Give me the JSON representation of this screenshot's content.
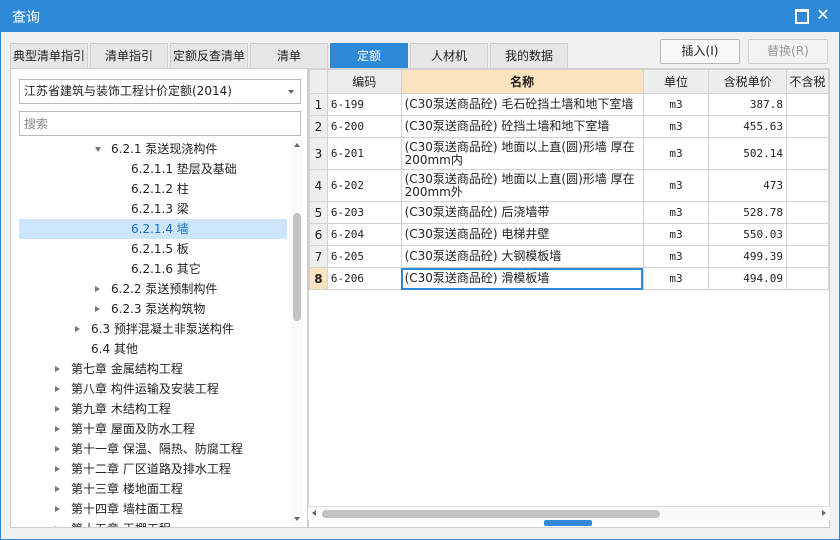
{
  "window": {
    "title": "查询"
  },
  "tabs": [
    {
      "label": "典型清单指引"
    },
    {
      "label": "清单指引"
    },
    {
      "label": "定额反查清单"
    },
    {
      "label": "清单"
    },
    {
      "label": "定额"
    },
    {
      "label": "人材机"
    },
    {
      "label": "我的数据"
    }
  ],
  "active_tab": "定额",
  "toolbar": {
    "insert_label": "插入(I)",
    "replace_label": "替换(R)"
  },
  "left": {
    "dropdown_value": "江苏省建筑与装饰工程计价定额(2014)",
    "search_placeholder": "搜索",
    "tree": [
      {
        "label": "6.2.1 泵送现浇构件",
        "level": 2,
        "arrow": "down"
      },
      {
        "label": "6.2.1.1 垫层及基础",
        "level": 3,
        "arrow": ""
      },
      {
        "label": "6.2.1.2 柱",
        "level": 3,
        "arrow": ""
      },
      {
        "label": "6.2.1.3 梁",
        "level": 3,
        "arrow": ""
      },
      {
        "label": "6.2.1.4 墙",
        "level": 3,
        "arrow": "",
        "selected": true
      },
      {
        "label": "6.2.1.5 板",
        "level": 3,
        "arrow": ""
      },
      {
        "label": "6.2.1.6 其它",
        "level": 3,
        "arrow": ""
      },
      {
        "label": "6.2.2 泵送预制构件",
        "level": 2,
        "arrow": "right"
      },
      {
        "label": "6.2.3 泵送构筑物",
        "level": 2,
        "arrow": "right"
      },
      {
        "label": "6.3 预拌混凝土非泵送构件",
        "level": 1,
        "arrow": "right"
      },
      {
        "label": "6.4 其他",
        "level": 1,
        "arrow": ""
      },
      {
        "label": "第七章 金属结构工程",
        "level": 0,
        "arrow": "right"
      },
      {
        "label": "第八章 构件运输及安装工程",
        "level": 0,
        "arrow": "right"
      },
      {
        "label": "第九章 木结构工程",
        "level": 0,
        "arrow": "right"
      },
      {
        "label": "第十章 屋面及防水工程",
        "level": 0,
        "arrow": "right"
      },
      {
        "label": "第十一章 保温、隔热、防腐工程",
        "level": 0,
        "arrow": "right"
      },
      {
        "label": "第十二章 厂区道路及排水工程",
        "level": 0,
        "arrow": "right"
      },
      {
        "label": "第十三章 楼地面工程",
        "level": 0,
        "arrow": "right"
      },
      {
        "label": "第十四章 墙柱面工程",
        "level": 0,
        "arrow": "right"
      },
      {
        "label": "第十五章 天棚工程",
        "level": 0,
        "arrow": "right"
      }
    ]
  },
  "grid": {
    "columns": [
      "编码",
      "名称",
      "单位",
      "含税单价",
      "不含税"
    ],
    "rows": [
      {
        "idx": "1",
        "code": "6-199",
        "name": "(C30泵送商品砼) 毛石砼挡土墙和地下室墙",
        "unit": "m3",
        "price": "387.8"
      },
      {
        "idx": "2",
        "code": "6-200",
        "name": "(C30泵送商品砼) 砼挡土墙和地下室墙",
        "unit": "m3",
        "price": "455.63"
      },
      {
        "idx": "3",
        "code": "6-201",
        "name": "(C30泵送商品砼) 地面以上直(圆)形墙 厚在200mm内",
        "unit": "m3",
        "price": "502.14",
        "tall": true
      },
      {
        "idx": "4",
        "code": "6-202",
        "name": "(C30泵送商品砼) 地面以上直(圆)形墙 厚在200mm外",
        "unit": "m3",
        "price": "473",
        "tall": true
      },
      {
        "idx": "5",
        "code": "6-203",
        "name": "(C30泵送商品砼) 后浇墙带",
        "unit": "m3",
        "price": "528.78"
      },
      {
        "idx": "6",
        "code": "6-204",
        "name": "(C30泵送商品砼) 电梯井壁",
        "unit": "m3",
        "price": "550.03"
      },
      {
        "idx": "7",
        "code": "6-205",
        "name": "(C30泵送商品砼) 大钢模板墙",
        "unit": "m3",
        "price": "499.39"
      },
      {
        "idx": "8",
        "code": "6-206",
        "name": "(C30泵送商品砼) 滑模板墙",
        "unit": "m3",
        "price": "494.09",
        "current": true
      }
    ]
  }
}
